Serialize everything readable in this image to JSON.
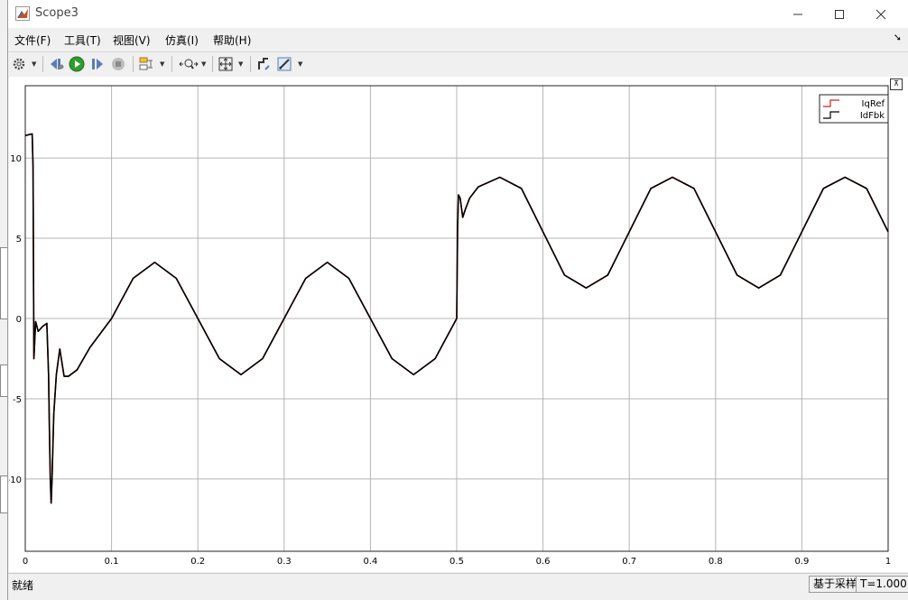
{
  "window": {
    "title": "Scope3",
    "minimize": "—",
    "maximize": "☐",
    "close": "✕"
  },
  "menu": {
    "items": [
      "文件(F)",
      "工具(T)",
      "视图(V)",
      "仿真(I)",
      "帮助(H)"
    ],
    "overflow_icon": "dock-arrow-icon"
  },
  "toolbar": {
    "icons": [
      "settings-icon",
      "step-back-icon",
      "run-icon",
      "step-forward-icon",
      "stop-icon",
      "signal-highlight-icon",
      "zoom-icon",
      "fit-icon",
      "style-icon",
      "measure-icon"
    ]
  },
  "status": {
    "left": "就绪",
    "sample": "基于采样",
    "time": "T=1.000"
  },
  "colors": {
    "axes_bg": "#ffffff",
    "grid": "#b4b4b4",
    "series_1": "#d02020",
    "series_2": "#000000"
  },
  "chart_data": {
    "type": "line",
    "xlim": [
      0,
      1
    ],
    "ylim": [
      -14.5,
      14.5
    ],
    "xticks": [
      0,
      0.1,
      0.2,
      0.3,
      0.4,
      0.5,
      0.6,
      0.7,
      0.8,
      0.9,
      1
    ],
    "xtick_labels": [
      "0",
      "0.1",
      "0.2",
      "0.3",
      "0.4",
      "0.5",
      "0.6",
      "0.7",
      "0.8",
      "0.9",
      "1"
    ],
    "yticks": [
      -10,
      -5,
      0,
      5,
      10
    ],
    "ytick_labels": [
      "-10",
      "-5",
      "0",
      "5",
      "10"
    ],
    "grid": true,
    "legend_position": "top-right",
    "series": [
      {
        "name": "IqRef",
        "x": [
          0,
          0.008,
          0.009,
          0.01,
          0.012,
          0.015,
          0.02,
          0.025,
          0.027,
          0.028,
          0.029,
          0.03,
          0.031,
          0.033,
          0.036,
          0.04,
          0.045,
          0.05,
          0.06,
          0.075,
          0.1,
          0.125,
          0.15,
          0.175,
          0.2,
          0.225,
          0.25,
          0.275,
          0.3,
          0.325,
          0.35,
          0.375,
          0.4,
          0.425,
          0.45,
          0.475,
          0.5,
          0.501,
          0.502,
          0.504,
          0.507,
          0.51,
          0.515,
          0.525,
          0.55,
          0.575,
          0.6,
          0.625,
          0.65,
          0.675,
          0.7,
          0.725,
          0.75,
          0.775,
          0.8,
          0.825,
          0.85,
          0.875,
          0.9,
          0.925,
          0.95,
          0.975,
          1.0
        ],
        "y": [
          11.4,
          11.5,
          9.5,
          -2.5,
          -0.2,
          -0.8,
          -0.5,
          -0.3,
          -3.5,
          -7,
          -10,
          -11.5,
          -10,
          -6,
          -3.5,
          -1.9,
          -3.6,
          -3.6,
          -3.2,
          -1.8,
          0,
          2.5,
          3.5,
          2.5,
          0,
          -2.5,
          -3.5,
          -2.5,
          0,
          2.5,
          3.5,
          2.5,
          0,
          -2.5,
          -3.5,
          -2.5,
          0,
          5.5,
          7.7,
          7.5,
          6.3,
          6.8,
          7.5,
          8.2,
          8.8,
          8.1,
          5.4,
          2.7,
          1.9,
          2.7,
          5.4,
          8.1,
          8.8,
          8.1,
          5.4,
          2.7,
          1.9,
          2.7,
          5.4,
          8.1,
          8.8,
          8.1,
          5.4
        ]
      },
      {
        "name": "IdFbk",
        "x": [
          0,
          0.008,
          0.009,
          0.01,
          0.012,
          0.015,
          0.02,
          0.025,
          0.027,
          0.028,
          0.029,
          0.03,
          0.031,
          0.033,
          0.036,
          0.04,
          0.045,
          0.05,
          0.06,
          0.075,
          0.1,
          0.125,
          0.15,
          0.175,
          0.2,
          0.225,
          0.25,
          0.275,
          0.3,
          0.325,
          0.35,
          0.375,
          0.4,
          0.425,
          0.45,
          0.475,
          0.5,
          0.501,
          0.502,
          0.504,
          0.507,
          0.51,
          0.515,
          0.525,
          0.55,
          0.575,
          0.6,
          0.625,
          0.65,
          0.675,
          0.7,
          0.725,
          0.75,
          0.775,
          0.8,
          0.825,
          0.85,
          0.875,
          0.9,
          0.925,
          0.95,
          0.975,
          1.0
        ],
        "y": [
          11.4,
          11.5,
          9.5,
          -2.5,
          -0.2,
          -0.8,
          -0.5,
          -0.3,
          -3.5,
          -7,
          -10,
          -11.5,
          -10,
          -6,
          -3.5,
          -1.9,
          -3.6,
          -3.6,
          -3.2,
          -1.8,
          0,
          2.5,
          3.5,
          2.5,
          0,
          -2.5,
          -3.5,
          -2.5,
          0,
          2.5,
          3.5,
          2.5,
          0,
          -2.5,
          -3.5,
          -2.5,
          0,
          5.5,
          7.7,
          7.5,
          6.3,
          6.8,
          7.5,
          8.2,
          8.8,
          8.1,
          5.4,
          2.7,
          1.9,
          2.7,
          5.4,
          8.1,
          8.8,
          8.1,
          5.4,
          2.7,
          1.9,
          2.7,
          5.4,
          8.1,
          8.8,
          8.1,
          5.4
        ]
      }
    ]
  }
}
